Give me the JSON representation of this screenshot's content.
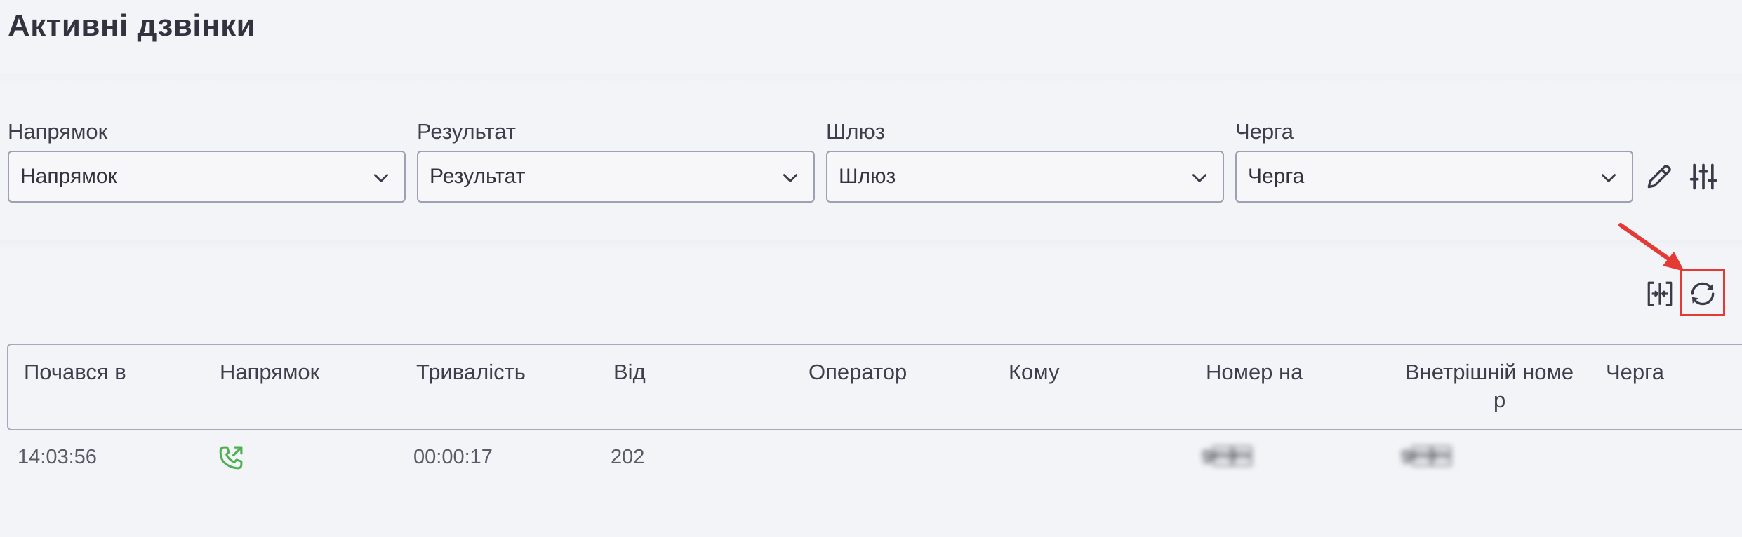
{
  "page": {
    "title": "Активні дзвінки"
  },
  "filters": [
    {
      "label": "Напрямок",
      "value": "Напрямок"
    },
    {
      "label": "Результат",
      "value": "Результат"
    },
    {
      "label": "Шлюз",
      "value": "Шлюз"
    },
    {
      "label": "Черга",
      "value": "Черга"
    }
  ],
  "toolbar": {
    "icons": [
      "pencil-icon",
      "sliders-icon",
      "expand-columns-icon",
      "refresh-icon"
    ],
    "highlight_color": "#e53935"
  },
  "table": {
    "columns": [
      "Почався в",
      "Напрямок",
      "Тривалість",
      "Від",
      "Оператор",
      "Кому",
      "Номер на",
      "Внетрішній номе",
      "р",
      "Черга"
    ],
    "rows": [
      {
        "started": "14:03:56",
        "direction_icon": "outgoing-call-icon",
        "duration": "00:00:17",
        "from": "202",
        "operator": "",
        "to": "",
        "number_on": "9\u0003\u0003",
        "internal": "9\u0003\u0003",
        "queue": ""
      }
    ],
    "direction_icon_color": "#4caf50"
  }
}
